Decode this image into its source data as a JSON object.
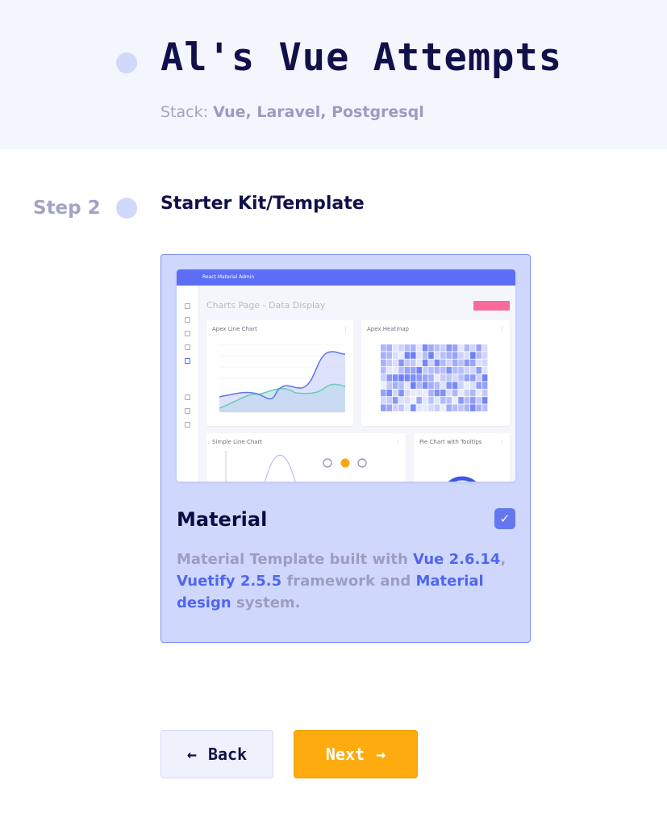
{
  "header": {
    "title": "Al's Vue Attempts",
    "stack_label": "Stack:",
    "stack_value": "Vue, Laravel, Postgresql"
  },
  "step": {
    "label": "Step 2",
    "title": "Starter Kit/Template"
  },
  "card": {
    "preview": {
      "app_title": "React Material Admin",
      "page_title": "Charts Page - Data Display",
      "cards": [
        "Apex Line Chart",
        "Apex Heatmap",
        "Simple Line Chart",
        "Pie Chart with Tooltips"
      ]
    },
    "title": "Material",
    "checked": true,
    "description": {
      "t1": "Material Template built with ",
      "h1": "Vue 2.6.14",
      "t2": ", ",
      "h2": "Vuetify 2.5.5",
      "t3": " framework and ",
      "h3": "Material design",
      "t4": " system."
    }
  },
  "colors": {
    "accent": "#5066f0",
    "next": "#fdab0f",
    "dark": "#10104a"
  },
  "buttons": {
    "back": "Back",
    "back_icon": "←",
    "next": "Next",
    "next_icon": "→"
  }
}
